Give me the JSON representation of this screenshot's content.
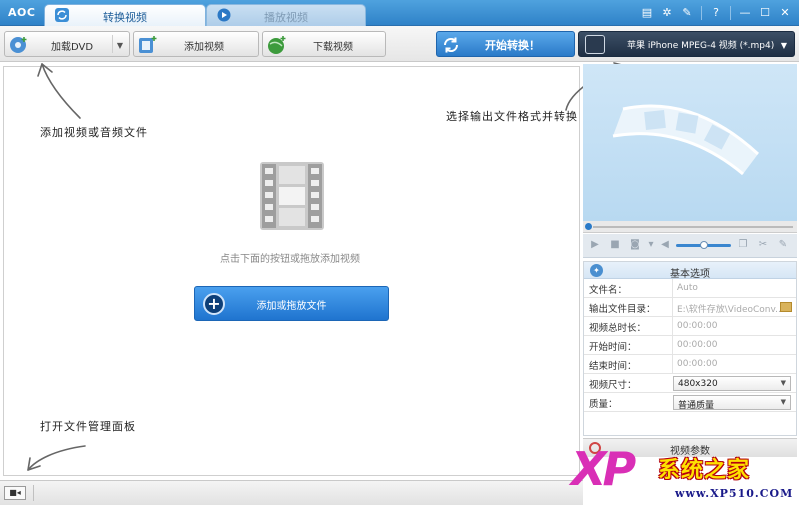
{
  "app": {
    "logo": "AOC",
    "tabs": [
      {
        "label": "转换视频",
        "active": true
      },
      {
        "label": "播放视频",
        "active": false
      }
    ],
    "window_buttons": [
      "menu-icon",
      "gear-icon",
      "tool-icon",
      "help-icon",
      "minimize-icon",
      "maximize-icon",
      "close-icon"
    ]
  },
  "toolbar": {
    "load_dvd": "加载DVD",
    "add_video": "添加视频",
    "download_video": "下载视频",
    "start_convert": "开始转换！",
    "output_format": "苹果 iPhone MPEG-4 视频 (*.mp4)"
  },
  "main": {
    "hint_add": "添加视频或音频文件",
    "hint_format": "选择输出文件格式并转换",
    "hint_panel": "打开文件管理面板",
    "drop_text": "点击下面的按钮或拖放添加视频",
    "drop_button": "添加或拖放文件"
  },
  "options": {
    "title": "基本选项",
    "rows": [
      {
        "label": "文件名：",
        "value": "Auto"
      },
      {
        "label": "输出文件目录：",
        "value": "E:\\软件存放\\VideoConv..."
      },
      {
        "label": "视频总时长：",
        "value": "00:00:00"
      },
      {
        "label": "开始时间：",
        "value": "00:00:00"
      },
      {
        "label": "结束时间：",
        "value": "00:00:00"
      },
      {
        "label": "视频尺寸：",
        "value": "480x320"
      },
      {
        "label": "质量：",
        "value": "普通质量"
      }
    ],
    "video_params": "视频参数"
  },
  "watermark": {
    "logo": "XP",
    "title": "系统之家",
    "url": "www.XP510.COM"
  },
  "colors": {
    "titlebar": "#3a8fd6",
    "start_button": "#2a7ac8",
    "format_button": "#2a3a4f",
    "drop_button": "#1f74cf"
  }
}
